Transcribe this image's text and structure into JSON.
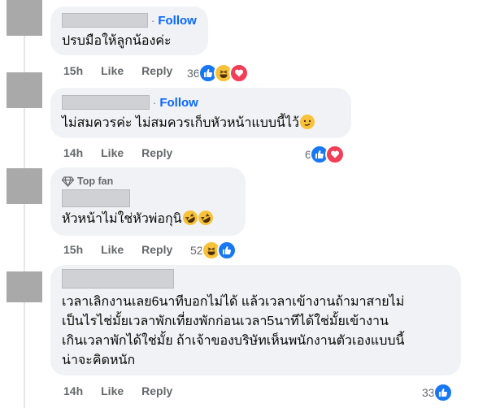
{
  "comments": [
    {
      "follow": "Follow",
      "text": "ปรบมือให้ลูกน้องค่ะ",
      "time": "15h",
      "like": "Like",
      "reply": "Reply",
      "reaction_count": "36",
      "reactions": [
        "like-icon",
        "haha-icon",
        "love-icon"
      ]
    },
    {
      "separator": "·",
      "follow": "Follow",
      "text": "ไม่สมควรค่ะ ไม่สมควรเก็บหัวหน้าแบบนี้ไว้",
      "time": "14h",
      "like": "Like",
      "reply": "Reply",
      "reaction_count": "6",
      "reactions": [
        "like-icon",
        "love-icon"
      ]
    },
    {
      "badge": "Top fan",
      "text": "หัวหน้าไม่ใช่หัวพ่อกุนิ",
      "time": "15h",
      "like": "Like",
      "reply": "Reply",
      "reaction_count": "52",
      "reactions": [
        "haha-icon",
        "like-icon"
      ]
    },
    {
      "text_lines": [
        "เวลาเลิกงานเลย6นาทีบอกไม่ได้ แล้วเวลาเข้างานถ้ามาสายไม่",
        "เป็นไรไช่มั้ยเวลาพักเที่ยงพักก่อนเวลา5นาทีได้ใช่มั้ยเข้างาน",
        "เกินเวลาพักได้ใช่มั้ย ถ้าเจ้าของบริษัทเห็นพนักงานตัวเองแบบนี้",
        "น่าจะคิดหนัก"
      ],
      "time": "14h",
      "like": "Like",
      "reply": "Reply",
      "reaction_count": "33",
      "reactions": [
        "like-icon"
      ]
    }
  ],
  "colors": {
    "link": "#0866ff",
    "bubble": "#f0f2f5",
    "meta": "#65676b",
    "like": "#1877f2",
    "haha": "#f7c23a",
    "love": "#f33e58"
  }
}
